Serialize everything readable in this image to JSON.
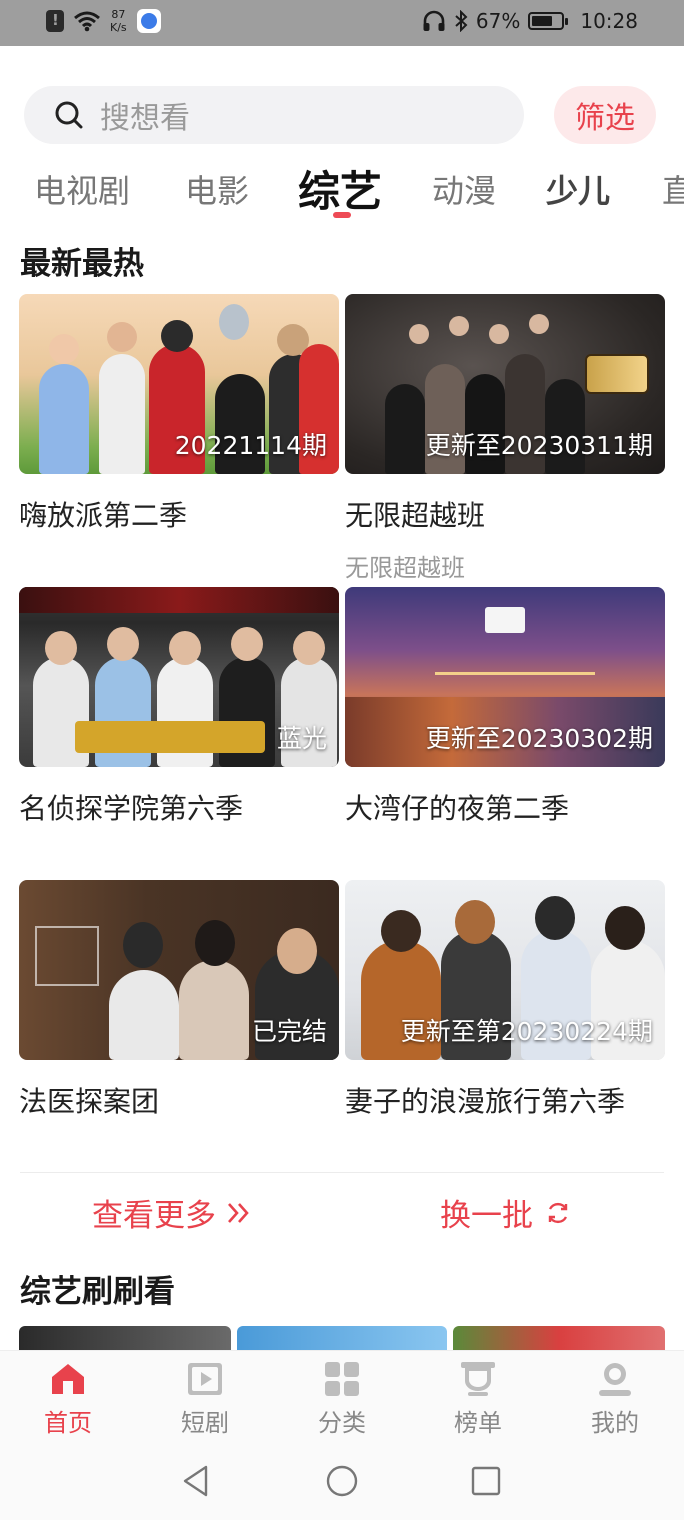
{
  "status_bar": {
    "net_speed_value": "87",
    "net_speed_unit": "K/s",
    "battery": "67%",
    "time": "10:28"
  },
  "search": {
    "placeholder": "搜想看",
    "filter_label": "筛选"
  },
  "tabs": [
    {
      "label": "电视剧"
    },
    {
      "label": "电影"
    },
    {
      "label": "综艺",
      "active": true
    },
    {
      "label": "动漫"
    },
    {
      "label": "少儿"
    },
    {
      "label": "直"
    }
  ],
  "section1": {
    "title": "最新最热",
    "cards": [
      {
        "title": "嗨放派第二季",
        "badge": "20221114期",
        "subtitle": ""
      },
      {
        "title": "无限超越班",
        "badge": "更新至20230311期",
        "subtitle": "无限超越班"
      },
      {
        "title": "名侦探学院第六季",
        "badge": "蓝光",
        "subtitle": ""
      },
      {
        "title": "大湾仔的夜第二季",
        "badge": "更新至20230302期",
        "subtitle": ""
      },
      {
        "title": "法医探案团",
        "badge": "已完结",
        "subtitle": ""
      },
      {
        "title": "妻子的浪漫旅行第六季",
        "badge": "更新至第20230224期",
        "subtitle": ""
      }
    ]
  },
  "actions": {
    "more_label": "查看更多",
    "swap_label": "换一批"
  },
  "section2": {
    "title": "综艺刷刷看"
  },
  "bottom_nav": [
    {
      "label": "首页",
      "icon": "home-icon",
      "active": true
    },
    {
      "label": "短剧",
      "icon": "play-icon"
    },
    {
      "label": "分类",
      "icon": "grid-icon"
    },
    {
      "label": "榜单",
      "icon": "ranking-icon"
    },
    {
      "label": "我的",
      "icon": "profile-icon"
    }
  ],
  "colors": {
    "accent": "#e8424c",
    "accent_light": "#fde9ea",
    "status_bar": "#9e9e9e"
  }
}
